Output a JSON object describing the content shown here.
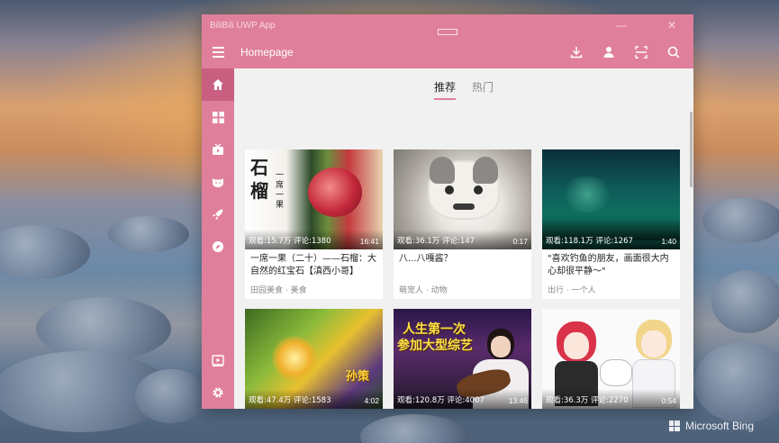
{
  "window": {
    "title": "BiliBili UWP App",
    "min_label": "—",
    "close_label": "✕"
  },
  "header": {
    "page_title": "Homepage"
  },
  "tabs": [
    {
      "label": "推荐",
      "active": true
    },
    {
      "label": "热门",
      "active": false
    }
  ],
  "sidebar": {
    "items": [
      {
        "icon": "home-icon",
        "active": true
      },
      {
        "icon": "category-icon",
        "active": false
      },
      {
        "icon": "live-icon",
        "active": false
      },
      {
        "icon": "bangumi-icon",
        "active": false
      },
      {
        "icon": "rocket-icon",
        "active": false
      },
      {
        "icon": "explore-icon",
        "active": false
      }
    ],
    "bottom_items": [
      {
        "icon": "video-play-icon"
      },
      {
        "icon": "settings-icon"
      }
    ]
  },
  "videos": [
    {
      "stat": "观看:15.7万 评论:1380",
      "duration": "16:41",
      "title": "一席一果（二十）——石榴：大自然的红宝石【滇西小哥】",
      "meta": "田园美食 · 美食",
      "thumb_text_1": "石",
      "thumb_text_2": "榴",
      "thumb_text_3": "一席一果"
    },
    {
      "stat": "观看:36.1万 评论:147",
      "duration": "0:17",
      "title": "八...八嘎酱？",
      "meta": "萌宠人 · 动物",
      "thumb_text_1": "",
      "thumb_text_2": "",
      "thumb_text_3": ""
    },
    {
      "stat": "观看:118.1万 评论:1267",
      "duration": "1:40",
      "title": "\"喜欢钓鱼的朋友，画面很大内心却很平静～\"",
      "meta": "出行 · 一个人",
      "thumb_text_1": "",
      "thumb_text_2": "",
      "thumb_text_3": ""
    },
    {
      "stat": "观看:47.4万 评论:1583",
      "duration": "4:02",
      "title": "",
      "meta": "",
      "thumb_text_1": "孙策",
      "thumb_text_2": "",
      "thumb_text_3": ""
    },
    {
      "stat": "观看:120.8万 评论:4007",
      "duration": "13:46",
      "title": "",
      "meta": "",
      "thumb_text_1": "人生第一次",
      "thumb_text_2": "参加大型综艺",
      "thumb_text_3": ""
    },
    {
      "stat": "观看:36.3万 评论:2270",
      "duration": "0:54",
      "title": "",
      "meta": "",
      "thumb_text_1": "",
      "thumb_text_2": "",
      "thumb_text_3": ""
    }
  ],
  "desktop": {
    "watermark": "Microsoft Bing"
  },
  "colors": {
    "accent": "#e07f9c",
    "accent_active": "#c85f80",
    "content_bg": "#f1f1f1"
  }
}
